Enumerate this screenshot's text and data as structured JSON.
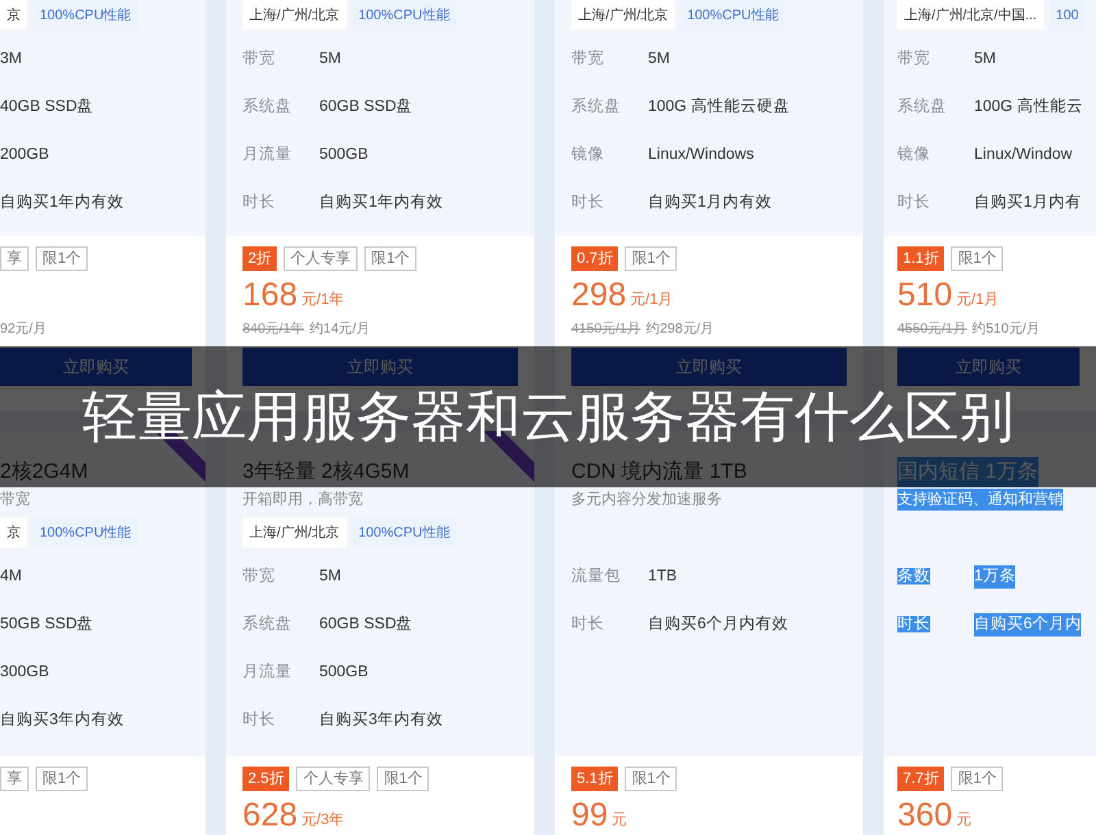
{
  "top_cards": [
    {
      "tags": [
        "京",
        "100%CPU性能"
      ],
      "specs": [
        {
          "value": "3M"
        },
        {
          "value": "40GB SSD盘"
        },
        {
          "value": "200GB"
        },
        {
          "value": "自购买1年内有效"
        }
      ],
      "badges": [
        {
          "text": "享",
          "kind": "plain"
        },
        {
          "text": "限1个",
          "kind": "plain"
        }
      ],
      "price_note": {
        "monthly": "92元/月"
      },
      "button": "立即购买"
    },
    {
      "tags": [
        "上海/广州/北京",
        "100%CPU性能"
      ],
      "specs": [
        {
          "label": "带宽",
          "value": "5M"
        },
        {
          "label": "系统盘",
          "value": "60GB SSD盘"
        },
        {
          "label": "月流量",
          "value": "500GB"
        },
        {
          "label": "时长",
          "value": "自购买1年内有效"
        }
      ],
      "badges": [
        {
          "text": "2折",
          "kind": "discount"
        },
        {
          "text": "个人专享",
          "kind": "plain"
        },
        {
          "text": "限1个",
          "kind": "plain"
        }
      ],
      "price": {
        "amount": "168",
        "unit": "元/1年"
      },
      "price_note": {
        "original": "840元/1年",
        "monthly": "约14元/月"
      },
      "button": "立即购买"
    },
    {
      "tags": [
        "上海/广州/北京",
        "100%CPU性能"
      ],
      "specs": [
        {
          "label": "带宽",
          "value": "5M"
        },
        {
          "label": "系统盘",
          "value": "100G 高性能云硬盘"
        },
        {
          "label": "镜像",
          "value": "Linux/Windows"
        },
        {
          "label": "时长",
          "value": "自购买1月内有效"
        }
      ],
      "badges": [
        {
          "text": "0.7折",
          "kind": "discount"
        },
        {
          "text": "限1个",
          "kind": "plain"
        }
      ],
      "price": {
        "amount": "298",
        "unit": "元/1月"
      },
      "price_note": {
        "original": "4150元/1月",
        "monthly": "约298元/月"
      },
      "button": "立即购买"
    },
    {
      "tags": [
        "上海/广州/北京/中国...",
        "100"
      ],
      "specs": [
        {
          "label": "带宽",
          "value": "5M"
        },
        {
          "label": "系统盘",
          "value": "100G 高性能云"
        },
        {
          "label": "镜像",
          "value": "Linux/Window"
        },
        {
          "label": "时长",
          "value": "自购买1月内有"
        }
      ],
      "badges": [
        {
          "text": "1.1折",
          "kind": "discount"
        },
        {
          "text": "限1个",
          "kind": "plain"
        }
      ],
      "price": {
        "amount": "510",
        "unit": "元/1月"
      },
      "price_note": {
        "original": "4550元/1月",
        "monthly": "约510元/月"
      },
      "button": "立即购买"
    }
  ],
  "bottom_cards": [
    {
      "title": "2核2G4M",
      "subtitle": "带宽",
      "ribbon": true,
      "highlighted": false,
      "tags": [
        "京",
        "100%CPU性能"
      ],
      "specs": [
        {
          "value": "4M"
        },
        {
          "value": "50GB SSD盘"
        },
        {
          "value": "300GB"
        },
        {
          "value": "自购买3年内有效"
        }
      ],
      "badges": [
        {
          "text": "享",
          "kind": "plain"
        },
        {
          "text": "限1个",
          "kind": "plain"
        }
      ]
    },
    {
      "title": "3年轻量 2核4G5M",
      "subtitle": "开箱即用，高带宽",
      "ribbon": true,
      "highlighted": false,
      "tags": [
        "上海/广州/北京",
        "100%CPU性能"
      ],
      "specs": [
        {
          "label": "带宽",
          "value": "5M"
        },
        {
          "label": "系统盘",
          "value": "60GB SSD盘"
        },
        {
          "label": "月流量",
          "value": "500GB"
        },
        {
          "label": "时长",
          "value": "自购买3年内有效"
        }
      ],
      "badges": [
        {
          "text": "2.5折",
          "kind": "discount"
        },
        {
          "text": "个人专享",
          "kind": "plain"
        },
        {
          "text": "限1个",
          "kind": "plain"
        }
      ],
      "price": {
        "amount": "628",
        "unit": "元/3年"
      }
    },
    {
      "title": "CDN 境内流量 1TB",
      "subtitle": "多元内容分发加速服务",
      "ribbon": false,
      "highlighted": false,
      "specs": [
        {
          "label": "流量包",
          "value": "1TB"
        },
        {
          "label": "时长",
          "value": "自购买6个月内有效"
        }
      ],
      "badges": [
        {
          "text": "5.1折",
          "kind": "discount"
        },
        {
          "text": "限1个",
          "kind": "plain"
        }
      ],
      "price": {
        "amount": "99",
        "unit": "元"
      }
    },
    {
      "title": "国内短信 1万条",
      "subtitle": "支持验证码、通知和营销",
      "ribbon": false,
      "highlighted": true,
      "specs": [
        {
          "label": "条数",
          "value": "1万条"
        },
        {
          "label": "时长",
          "value": "自购买6个月内"
        }
      ],
      "badges": [
        {
          "text": "7.7折",
          "kind": "discount"
        },
        {
          "text": "限1个",
          "kind": "plain"
        }
      ],
      "price": {
        "amount": "360",
        "unit": "元"
      }
    }
  ],
  "banner": {
    "title": "轻量应用服务器和云服务器有什么区别"
  }
}
